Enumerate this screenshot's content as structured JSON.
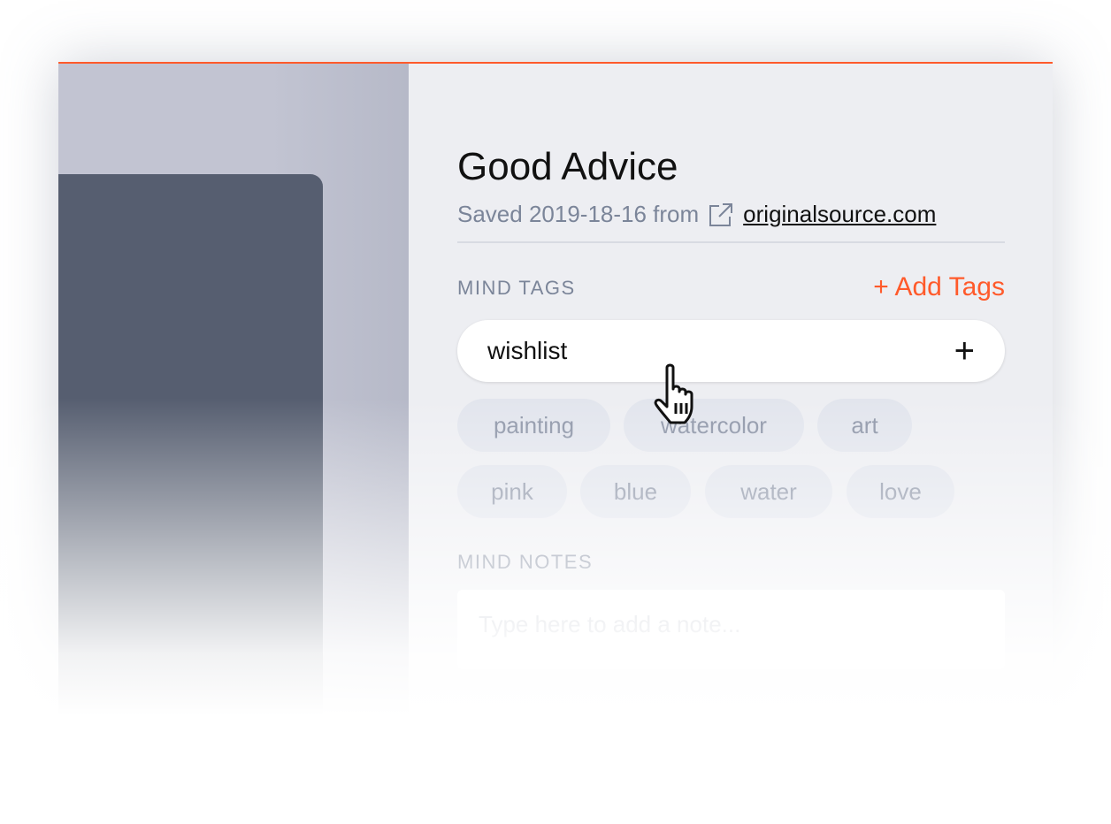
{
  "item": {
    "title": "Good Advice",
    "saved_text": "Saved 2019-18-16 from",
    "source_link": "originalsource.com"
  },
  "tags": {
    "label": "MIND TAGS",
    "add_label": "+ Add Tags",
    "input_value": "wishlist",
    "add_icon": "plus-icon",
    "chips": [
      "painting",
      "watercolor",
      "art",
      "pink",
      "blue",
      "water",
      "love"
    ]
  },
  "notes": {
    "label": "MIND NOTES",
    "placeholder": "Type here to add a note..."
  },
  "colors": {
    "accent": "#ff5a2b",
    "muted": "#7b8599",
    "chip_bg": "#e2e5ed"
  }
}
